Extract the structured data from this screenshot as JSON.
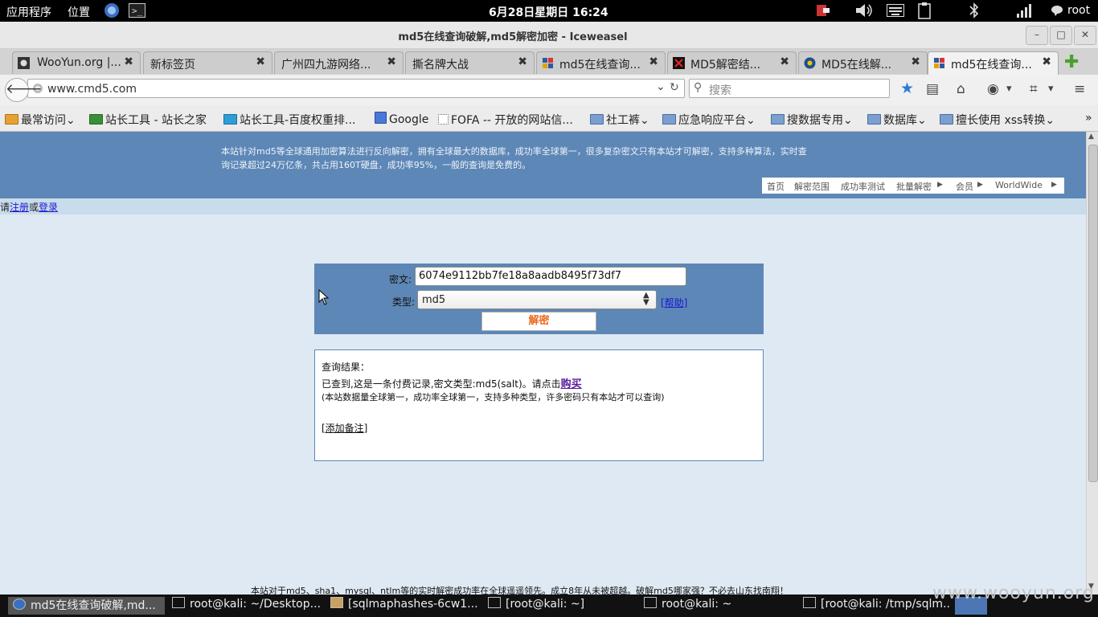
{
  "top_panel": {
    "applications": "应用程序",
    "places": "位置",
    "clock": "6月28日星期日 16:24",
    "user": "root"
  },
  "window": {
    "title": "md5在线查询破解,md5解密加密 - Iceweasel"
  },
  "tabs": [
    {
      "label": "WooYun.org |...",
      "favicon": "wooyun-icon"
    },
    {
      "label": "新标签页",
      "favicon": ""
    },
    {
      "label": "广州四九游网络...",
      "favicon": ""
    },
    {
      "label": "撕名牌大战",
      "favicon": ""
    },
    {
      "label": "md5在线查询...",
      "favicon": "cmd5-icon"
    },
    {
      "label": "MD5解密结...",
      "favicon": "x-icon"
    },
    {
      "label": "MD5在线解...",
      "favicon": "new-icon"
    },
    {
      "label": "md5在线查询...",
      "favicon": "cmd5-icon",
      "active": true
    }
  ],
  "navbar": {
    "url": "www.cmd5.com",
    "search_placeholder": "搜索"
  },
  "bookmarks": [
    {
      "label": "最常访问",
      "type": "folder"
    },
    {
      "label": "站长工具 - 站长之家",
      "type": "link"
    },
    {
      "label": "站长工具-百度权重排...",
      "type": "link"
    },
    {
      "label": "Google",
      "type": "link"
    },
    {
      "label": "FOFA -- 开放的网站信...",
      "type": "link"
    },
    {
      "label": "社工裤",
      "type": "folder"
    },
    {
      "label": "应急响应平台",
      "type": "folder"
    },
    {
      "label": "搜数据专用",
      "type": "folder"
    },
    {
      "label": "数据库",
      "type": "folder"
    },
    {
      "label": "擅长使用 xss转换",
      "type": "folder"
    }
  ],
  "page": {
    "intro_line1": "本站针对md5等全球通用加密算法进行反向解密，拥有全球最大的数据库，成功率全球第一，很多复杂密文只有本站才可解密，支持多种算法，实时查",
    "intro_line2": "询记录超过24万亿条，共占用160T硬盘，成功率95%，一般的查询是免费的。",
    "site_nav": [
      "首页",
      "解密范围",
      "成功率测试",
      "批量解密",
      "会员",
      "WorldWide"
    ],
    "login": {
      "prefix": "请",
      "register": "注册",
      "or": "或",
      "login": "登录"
    },
    "form": {
      "cipher_label": "密文:",
      "cipher_value": "6074e9112bb7fe18a8aadb8495f73df7",
      "type_label": "类型:",
      "type_value": "md5",
      "help": "[帮助]",
      "submit": "解密"
    },
    "result": {
      "heading": "查询结果：",
      "line1_prefix": "已查到,这是一条付费记录,密文类型:md5(salt)。请点击",
      "buy": "购买",
      "line2": "(本站数据量全球第一，成功率全球第一，支持多种类型，许多密码只有本站才可以查询)",
      "add_note": "[添加备注]"
    },
    "footer": "本站对于md5、sha1、mysql、ntlm等的实时解密成功率在全球遥遥领先。成立8年从未被超越。破解md5哪家强？不必去山东找南翔！"
  },
  "taskbar": [
    {
      "label": "md5在线查询破解,md...",
      "active": true
    },
    {
      "label": "root@kali: ~/Desktop..."
    },
    {
      "label": "[sqlmaphashes-6cw1..."
    },
    {
      "label": "[root@kali: ~]"
    },
    {
      "label": "root@kali: ~"
    },
    {
      "label": "[root@kali: /tmp/sqlm..."
    }
  ],
  "watermark": "www.wooyun.org"
}
